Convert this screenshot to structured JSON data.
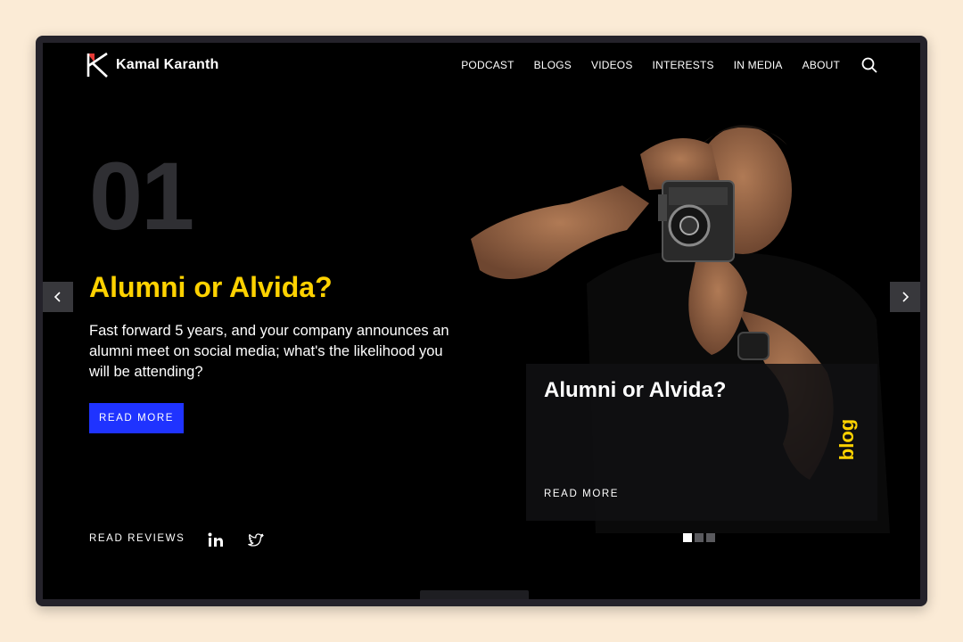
{
  "brand": {
    "name": "Kamal Karanth"
  },
  "nav": {
    "items": [
      "PODCAST",
      "BLOGS",
      "VIDEOS",
      "INTERESTS",
      "IN MEDIA",
      "ABOUT"
    ]
  },
  "slide": {
    "number": "01",
    "title": "Alumni or Alvida?",
    "text": "Fast forward 5 years, and your company announces an alumni meet on social media; what's the likelihood you will be attending?",
    "button": "READ MORE"
  },
  "card": {
    "title": "Alumni or Alvida?",
    "read_more": "READ MORE",
    "tag": "blog"
  },
  "footer": {
    "reviews": "READ REVIEWS"
  },
  "carousel": {
    "count": 3,
    "active": 1
  },
  "colors": {
    "accent_yellow": "#ffd200",
    "button_blue": "#1f33ff",
    "logo_red": "#e53935",
    "background": "#000000"
  },
  "icons": [
    "chevron-left-icon",
    "chevron-right-icon",
    "search-icon",
    "linkedin-icon",
    "twitter-icon"
  ]
}
